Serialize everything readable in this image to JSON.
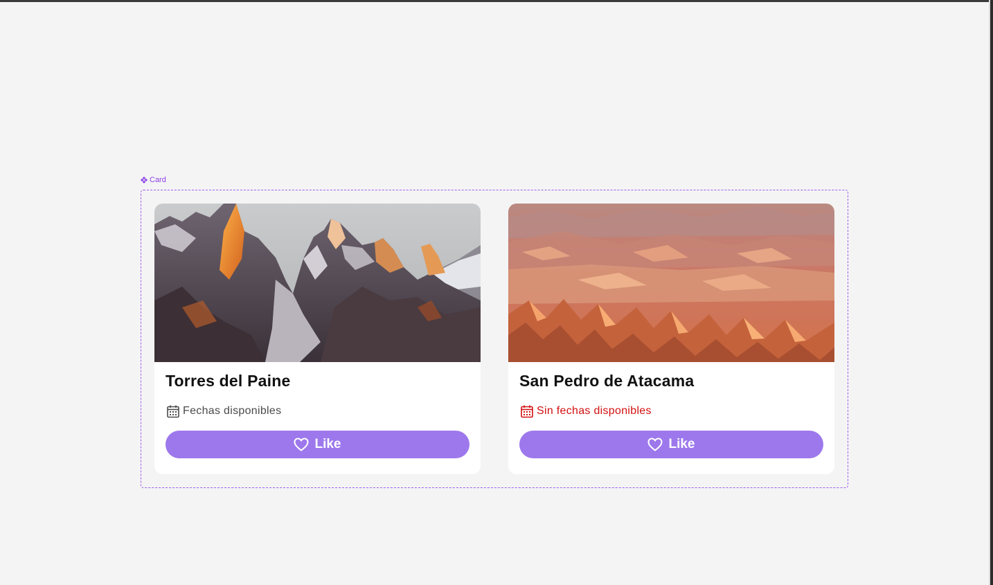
{
  "canvas": {
    "background": "#f4f4f4"
  },
  "component": {
    "label": "Card",
    "icon": "component-diamond-icon",
    "accent": "#8b3fe8"
  },
  "cards": [
    {
      "title": "Torres del Paine",
      "image": "mountain-peaks-sunset-photo",
      "availability_icon": "calendar-icon",
      "availability_text": "Fechas disponibles",
      "availability_status": "available",
      "availability_color": "#4a4a4a",
      "button_icon": "heart-icon",
      "button_label": "Like"
    },
    {
      "title": "San Pedro de Atacama",
      "image": "desert-valley-sunset-photo",
      "availability_icon": "calendar-icon",
      "availability_text": "Sin fechas disponibles",
      "availability_status": "unavailable",
      "availability_color": "#d20f0f",
      "button_icon": "heart-icon",
      "button_label": "Like"
    }
  ],
  "colors": {
    "button": "#9d78ec",
    "card": "#ffffff",
    "title": "#111111"
  }
}
